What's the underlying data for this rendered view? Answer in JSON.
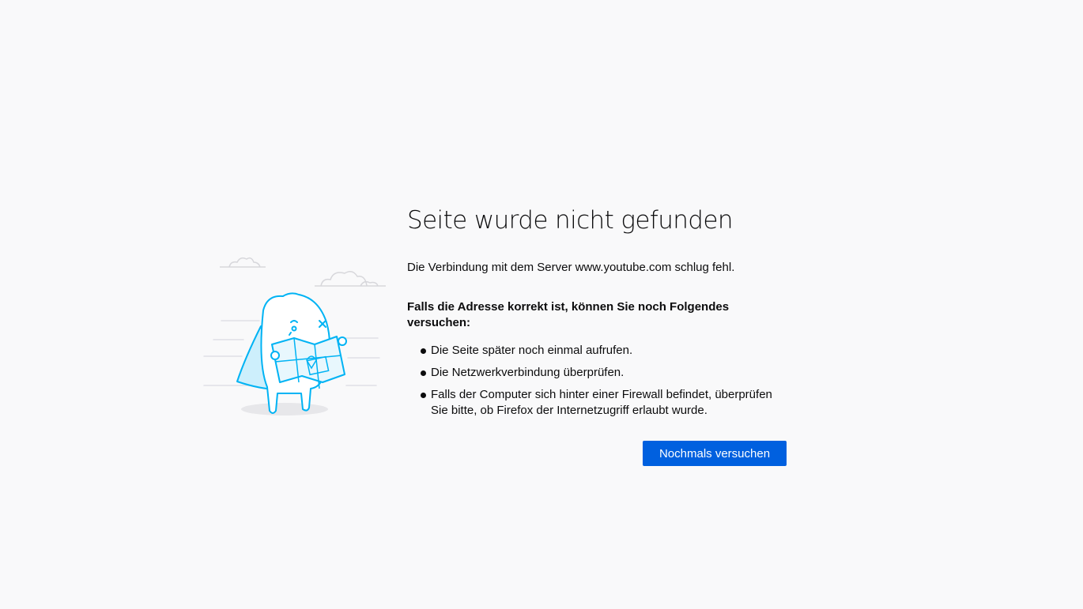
{
  "error_page": {
    "title": "Seite wurde nicht gefunden",
    "description": "Die Verbindung mit dem Server www.youtube.com schlug fehl.",
    "suggestions_heading": "Falls die Adresse korrekt ist, können Sie noch Folgendes versuchen:",
    "suggestions": [
      "Die Seite später noch einmal aufrufen.",
      "Die Netzwerkverbindung überprüfen.",
      "Falls der Computer sich hinter einer Firewall befindet, überprüfen Sie bitte, ob Firefox der Internetzugriff erlaubt wurde."
    ],
    "retry_label": "Nochmals versuchen",
    "illustration_icon": "lost-dino-with-map-icon"
  },
  "colors": {
    "background": "#f9f9fa",
    "accent": "#0060df",
    "illustration_stroke": "#00b3f4",
    "illustration_fill": "#cdeffc"
  }
}
